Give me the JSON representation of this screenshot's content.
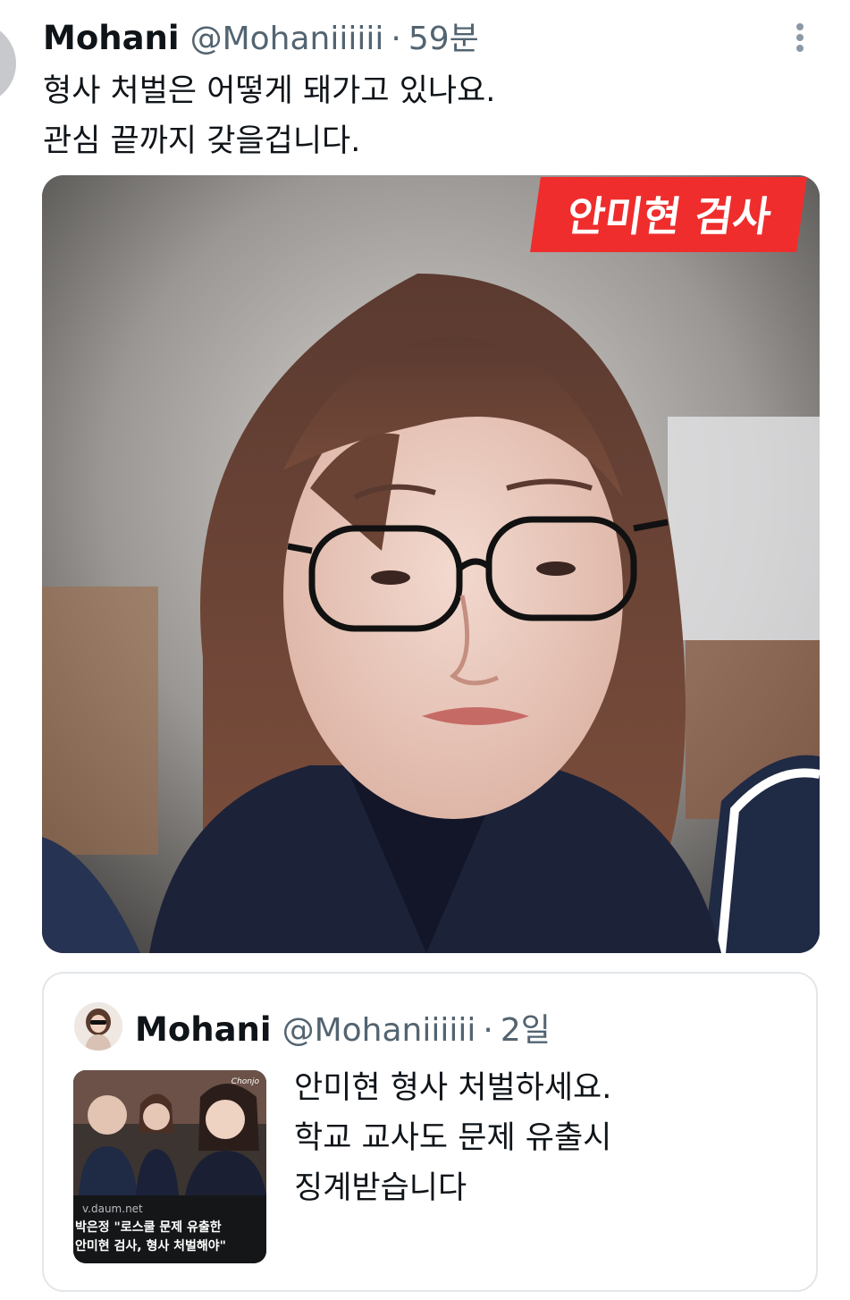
{
  "tweet": {
    "display_name": "Mohani",
    "handle": "@Mohaniiiiii",
    "separator": "·",
    "time": "59분",
    "text_lines": [
      "형사 처벌은 어떻게 돼가고 있나요.",
      "관심 끝까지 갖을겁니다."
    ],
    "media_tag": "안미현 검사"
  },
  "quoted_tweet": {
    "display_name": "Mohani",
    "handle": "@Mohaniiiiii",
    "separator": "·",
    "time": "2일",
    "text_lines": [
      "안미현 형사 처벌하세요.",
      "학교 교사도 문제 유출시",
      "징계받습니다"
    ],
    "thumbnail": {
      "brand": "Chonjo",
      "source": "v.daum.net",
      "headline_lines": [
        "박은정 \"로스쿨 문제 유출한",
        "안미현 검사, 형사 처벌해야\""
      ]
    }
  },
  "icons": {
    "more": "more-vertical-icon"
  },
  "colors": {
    "tag_red": "#ef2d2d",
    "secondary_text": "#536471",
    "border": "#e3e7ea"
  }
}
